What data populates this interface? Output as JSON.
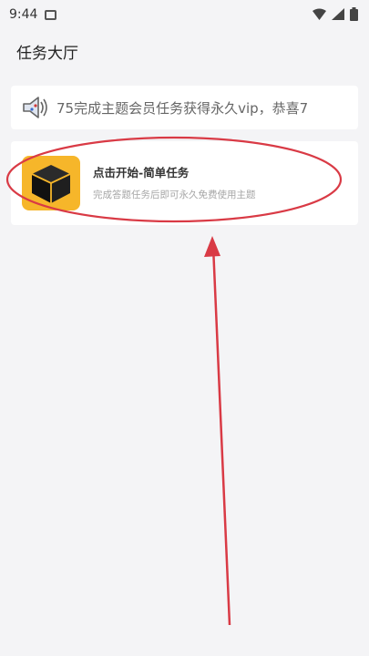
{
  "status_bar": {
    "time": "9:44",
    "icons": [
      "image-icon",
      "wifi-icon",
      "signal-icon",
      "battery-icon"
    ]
  },
  "page": {
    "title": "任务大厅"
  },
  "notice": {
    "icon": "speaker-icon",
    "text": "75完成主题会员任务获得永久vip，恭喜7"
  },
  "task_card": {
    "icon": "cube-box-icon",
    "title": "点击开始-简单任务",
    "subtitle": "完成答题任务后即可永久免费使用主题"
  },
  "annotation": {
    "color": "#d93a45",
    "shapes": [
      "red-ellipse-highlight",
      "red-arrow-pointing-up"
    ]
  },
  "colors": {
    "background": "#f4f4f6",
    "card": "#ffffff",
    "icon_bg": "#f6b62a",
    "annotation_red": "#d93a45"
  }
}
